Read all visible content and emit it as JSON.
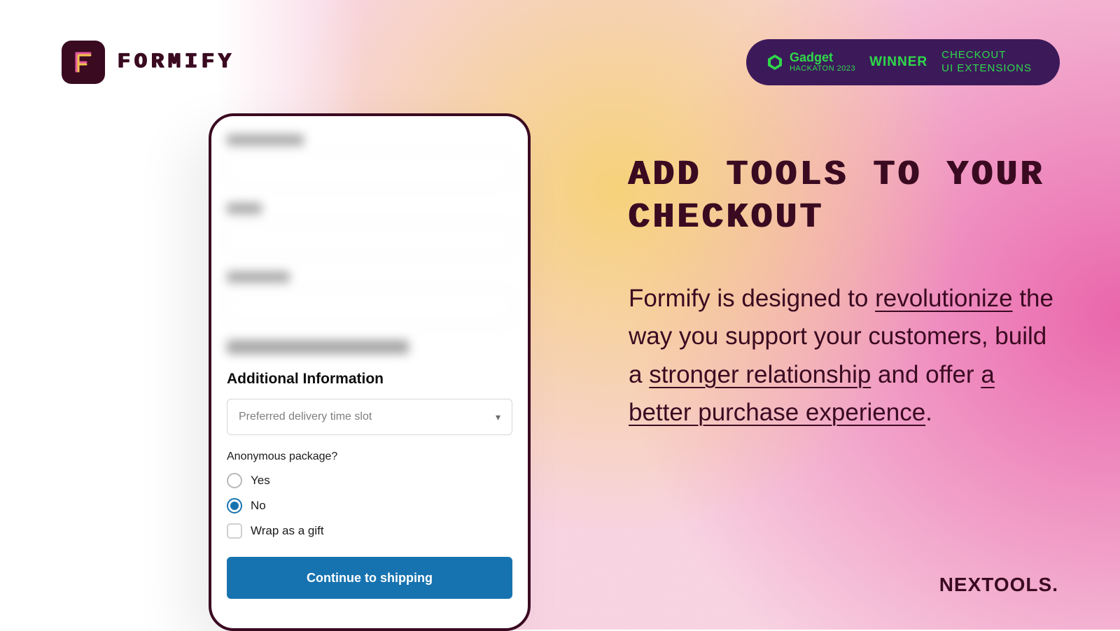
{
  "brand": {
    "name": "FORMIFY"
  },
  "badge": {
    "gadget_top": "Gadget",
    "gadget_bot": "HACKATON 2023",
    "winner": "WINNER",
    "ext_line1": "CHECKOUT",
    "ext_line2": "UI EXTENSIONS"
  },
  "phone": {
    "section_title": "Additional Information",
    "select_placeholder": "Preferred delivery time slot",
    "question": "Anonymous package?",
    "radio_yes": "Yes",
    "radio_no": "No",
    "checkbox_label": "Wrap as a gift",
    "cta": "Continue to shipping"
  },
  "hero": {
    "headline": "ADD TOOLS TO YOUR CHECKOUT",
    "desc_1": "Formify is designed to ",
    "desc_u1": "revolutionize",
    "desc_2": " the way you support your customers, build a ",
    "desc_u2": "stronger relationship",
    "desc_3": " and offer ",
    "desc_u3": "a better purchase experience",
    "desc_4": "."
  },
  "footer": {
    "brand": "NEXTOOLS"
  }
}
